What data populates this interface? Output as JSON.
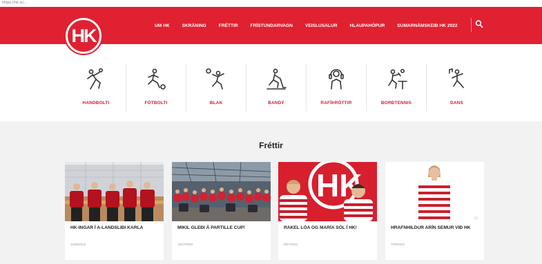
{
  "browser": {
    "url": "https://hk.is/..."
  },
  "logo": {
    "text": "HK"
  },
  "nav": {
    "items": [
      "UM HK",
      "SKRÁNING",
      "FRÉTTIR",
      "FRÍSTUNDARVAGN",
      "VEISLUSALUR",
      "HLAUPAHÓPUR",
      "SUMARNÁMSKEIÐ HK 2022"
    ]
  },
  "sports": [
    {
      "label": "HANDBOLTI",
      "icon": "handball-icon"
    },
    {
      "label": "FÓTBOLTI",
      "icon": "football-icon"
    },
    {
      "label": "BLAK",
      "icon": "volleyball-icon"
    },
    {
      "label": "BANDÝ",
      "icon": "bandy-icon"
    },
    {
      "label": "RAFÍÞRÓTTIR",
      "icon": "esports-icon"
    },
    {
      "label": "BORÐTENNIS",
      "icon": "table-tennis-icon"
    },
    {
      "label": "DANS",
      "icon": "dance-icon"
    }
  ],
  "news": {
    "title": "Fréttir",
    "cards": [
      {
        "title": "HK-INGAR Í A-LANDSLIÐI KARLA",
        "date": "11/08/2022"
      },
      {
        "title": "MIKIL GLEÐI Á PARTILLE CUP!",
        "date": "13/07/2022"
      },
      {
        "title": "RAKEL LÓA OG MARÍA SÓL Í HK!",
        "date": "8/07/2022"
      },
      {
        "title": "HRAFNHILDUR ARÍN SEMUR VIÐ HK",
        "date": "7/09/2022"
      }
    ]
  },
  "colors": {
    "brand_red": "#e02131",
    "label_red": "#c8202e",
    "news_bg": "#f2f2f2"
  }
}
